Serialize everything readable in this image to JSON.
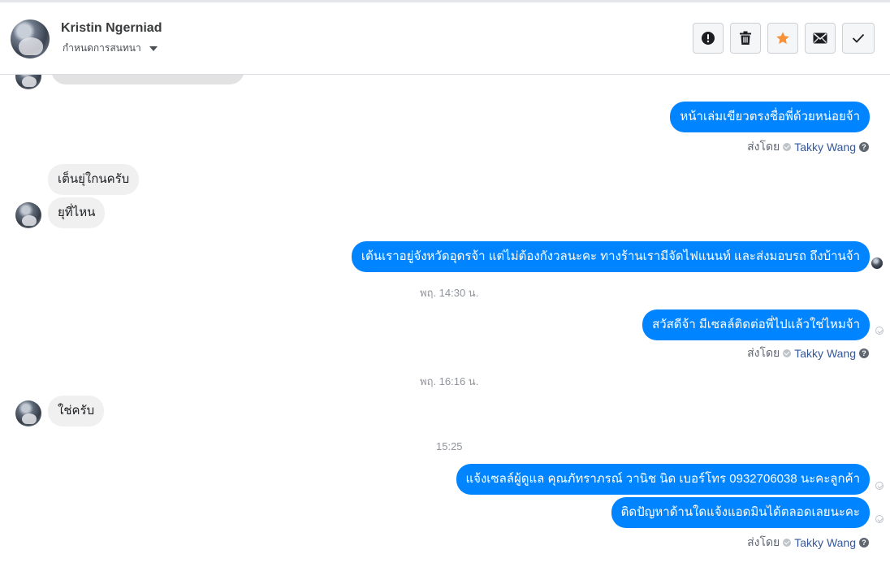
{
  "header": {
    "contact_name": "Kristin Ngerniad",
    "assign_label": "กำหนดการสนทนา",
    "actions": [
      {
        "icon": "exclamation-icon",
        "label": "Mark as spam"
      },
      {
        "icon": "trash-icon",
        "label": "Delete"
      },
      {
        "icon": "star-icon",
        "label": "Star"
      },
      {
        "icon": "envelope-icon",
        "label": "Mark as unread"
      },
      {
        "icon": "check-icon",
        "label": "Mark as done"
      }
    ],
    "star_color": "#f7923b"
  },
  "messages": [
    {
      "text": "หน้าเล่มเขียวตรงชื่อพี่ด้วยหน่อยจ้า"
    },
    {
      "text": "เต็นยุ่ใกนครับ"
    },
    {
      "text": "ยุที่ไหน"
    },
    {
      "text": "เต้นเราอยู่จังหวัดอุดรจ้า แต่ไม่ต้องกังวลนะคะ ทางร้านเรามีจัดไฟแนนท์ และส่งมอบรถ ถึงบ้านจ้า"
    },
    {
      "text": "สวัสดีจ้า มีเซลล์ติดต่อพี่ไปแล้วใช่ไหมจ้า"
    },
    {
      "text": "ใช่ครับ"
    },
    {
      "text": "แจ้งเซลล์ผู้ดูแล คุณภัทราภรณ์  วานิช     นิด เบอร์โทร 0932706038 นะคะลูกค้า"
    },
    {
      "text": "ติดปัญหาด้านใดแจ้งแอดมินได้ตลอดเลยนะคะ"
    }
  ],
  "sent_by": {
    "prefix": "ส่งโดย",
    "name": "Takky Wang"
  },
  "timestamps": [
    "พฤ. 14:30 น.",
    "พฤ. 16:16 น.",
    "15:25"
  ],
  "colors": {
    "outgoing": "#0084ff",
    "incoming": "#f0f0f0"
  }
}
